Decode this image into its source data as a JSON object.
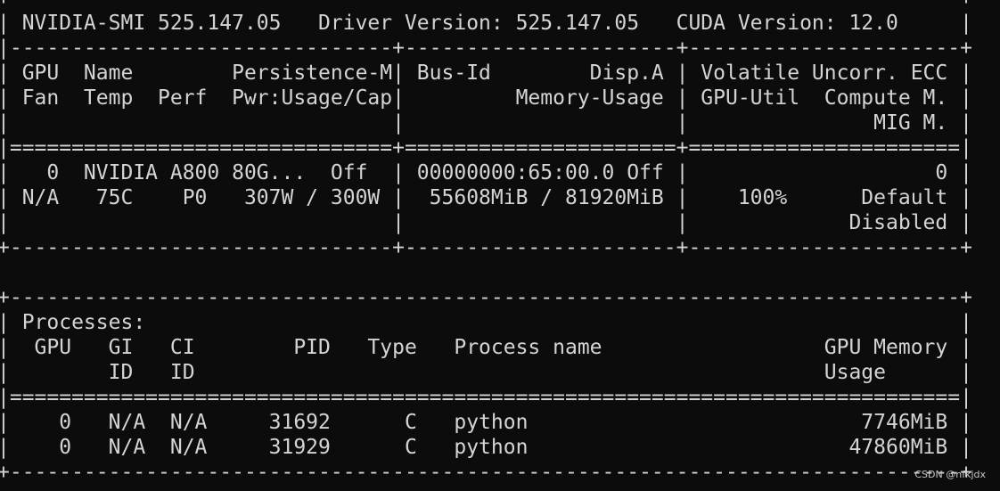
{
  "terminal": {
    "lines": [
      "+-----------------------------------------------------------------------------+",
      "| NVIDIA-SMI 525.147.05   Driver Version: 525.147.05   CUDA Version: 12.0     |",
      "|-------------------------------+----------------------+----------------------+",
      "| GPU  Name        Persistence-M| Bus-Id        Disp.A | Volatile Uncorr. ECC |",
      "| Fan  Temp  Perf  Pwr:Usage/Cap|         Memory-Usage | GPU-Util  Compute M. |",
      "|                               |                      |               MIG M. |",
      "|===============================+======================+======================|",
      "|   0  NVIDIA A800 80G...  Off  | 00000000:65:00.0 Off |                    0 |",
      "| N/A   75C    P0   307W / 300W |  55608MiB / 81920MiB |    100%      Default |",
      "|                               |                      |             Disabled |",
      "+-------------------------------+----------------------+----------------------+",
      "",
      "+-----------------------------------------------------------------------------+",
      "| Processes:                                                                  |",
      "|  GPU   GI   CI        PID   Type   Process name                  GPU Memory |",
      "|        ID   ID                                                   Usage      |",
      "|=============================================================================|",
      "|    0   N/A  N/A     31692      C   python                           7746MiB |",
      "|    0   N/A  N/A     31929      C   python                          47860MiB |",
      "+-----------------------------------------------------------------------------+"
    ]
  },
  "watermark": {
    "text": "CSDN @nfkjdx"
  }
}
